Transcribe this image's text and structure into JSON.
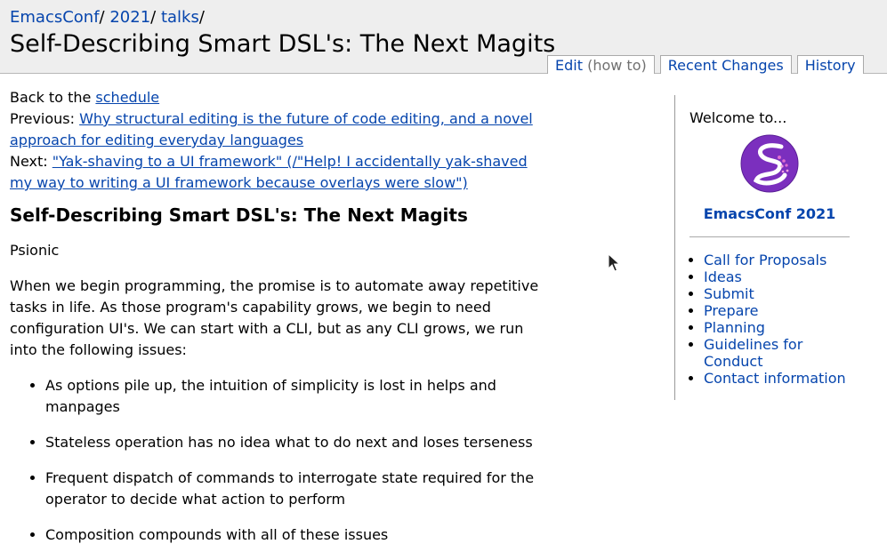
{
  "header": {
    "breadcrumb": [
      {
        "label": "EmacsConf",
        "sep": "/ "
      },
      {
        "label": "2021",
        "sep": "/ "
      },
      {
        "label": "talks",
        "sep": "/"
      }
    ],
    "title": "Self-Describing Smart DSL's: The Next Magits",
    "actions": {
      "edit_label": "Edit",
      "edit_howto": "(how to)",
      "recent_changes_label": "Recent Changes",
      "history_label": "History"
    }
  },
  "main": {
    "back": {
      "prefix": "Back to the ",
      "link": "schedule"
    },
    "previous": {
      "prefix": "Previous: ",
      "link": "Why structural editing is the future of code editing, and a novel approach for editing everyday languages"
    },
    "next": {
      "prefix": "Next: ",
      "link": "\"Yak-shaving to a UI framework\" (/\"Help! I accidentally yak-shaved my way to writing a UI framework because overlays were slow\")"
    },
    "talk_title": "Self-Describing Smart DSL's: The Next Magits",
    "speaker": "Psionic",
    "description": "When we begin programming, the promise is to automate away repetitive tasks in life. As those program's capability grows, we begin to need configuration UI's. We can start with a CLI, but as any CLI grows, we run into the following issues:",
    "issues": [
      "As options pile up, the intuition of simplicity is lost in helps and manpages",
      "Stateless operation has no idea what to do next and loses terseness",
      "Frequent dispatch of commands to interrogate state required for the operator to decide what action to perform",
      "Composition compounds with all of these issues"
    ]
  },
  "sidebar": {
    "welcome": "Welcome to...",
    "site_name": "EmacsConf 2021",
    "links": [
      "Call for Proposals",
      "Ideas",
      "Submit",
      "Prepare",
      "Planning",
      "Guidelines for Conduct",
      "Contact information"
    ]
  },
  "colors": {
    "link": "#0645ad",
    "header_bg": "#eeeeee",
    "logo_purple": "#7b2fbe",
    "logo_magenta": "#c850c0"
  }
}
